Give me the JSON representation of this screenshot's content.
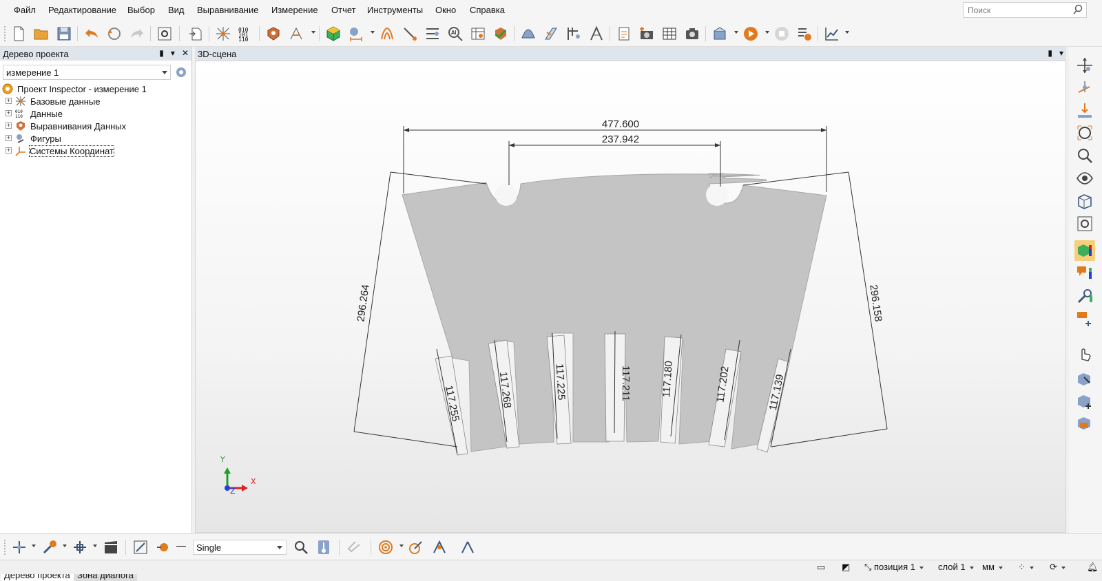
{
  "menu": {
    "file": "Файл",
    "edit": "Редактирование",
    "select": "Выбор",
    "view": "Вид",
    "align": "Выравнивание",
    "measure": "Измерение",
    "report": "Отчет",
    "tools": "Инструменты",
    "window": "Окно",
    "help": "Справка"
  },
  "search": {
    "placeholder": "Поиск"
  },
  "project_panel": {
    "title": "Дерево проекта",
    "selector_value": "измерение 1",
    "tree": {
      "root": "Проект Inspector - измерение 1",
      "items": [
        "Базовые данные",
        "Данные",
        "Выравнивания Данных",
        "Фигуры",
        "Системы Координат"
      ]
    },
    "tabs": [
      "Дерево проекта",
      "Зона диалога"
    ]
  },
  "scene": {
    "title": "3D-сцена",
    "dimensions": {
      "top_outer": "477.600",
      "top_inner": "237.942",
      "left_side": "296.264",
      "right_side": "296.158",
      "teeth": [
        "117.255",
        "117.268",
        "117.225",
        "117.211",
        "117.180",
        "117.202",
        "117.139"
      ]
    },
    "axes": {
      "x": "X",
      "y": "Y",
      "z": "Z"
    }
  },
  "bottom_toolbar": {
    "mode_value": "Single"
  },
  "status": {
    "position": "позиция 1",
    "layer": "слой 1",
    "units": "мм"
  },
  "colors": {
    "part_fill": "#c4c4c4",
    "panel_header": "#dfe5ec",
    "active_tool": "#f6cf7a",
    "axis_x": "#e02020",
    "axis_y": "#20a020",
    "axis_z": "#2040e0"
  }
}
